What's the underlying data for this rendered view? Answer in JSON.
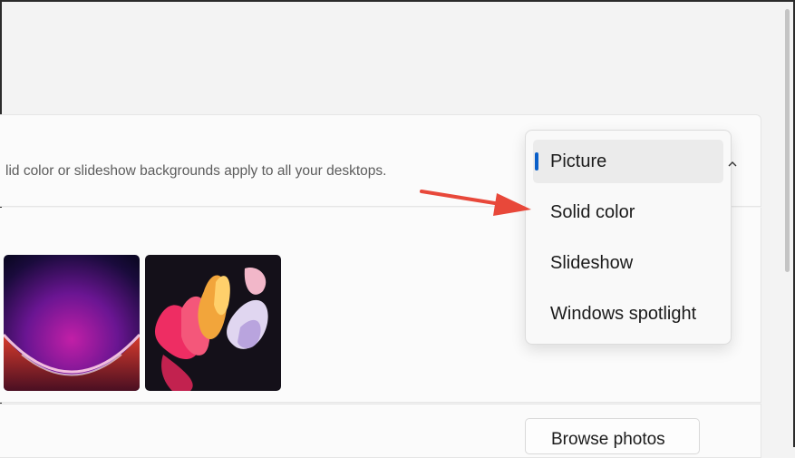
{
  "card": {
    "description": "lid color or slideshow backgrounds apply to all your desktops."
  },
  "dropdown": {
    "options": [
      {
        "label": "Picture",
        "selected": true
      },
      {
        "label": "Solid color",
        "selected": false
      },
      {
        "label": "Slideshow",
        "selected": false
      },
      {
        "label": "Windows spotlight",
        "selected": false
      }
    ]
  },
  "browse": {
    "label": "Browse photos"
  },
  "colors": {
    "accent": "#0a5fc9",
    "arrow": "#e8483a"
  },
  "icons": {
    "dropdown_chevron": "chevron-up-icon",
    "annotation": "red-arrow-annotation"
  }
}
